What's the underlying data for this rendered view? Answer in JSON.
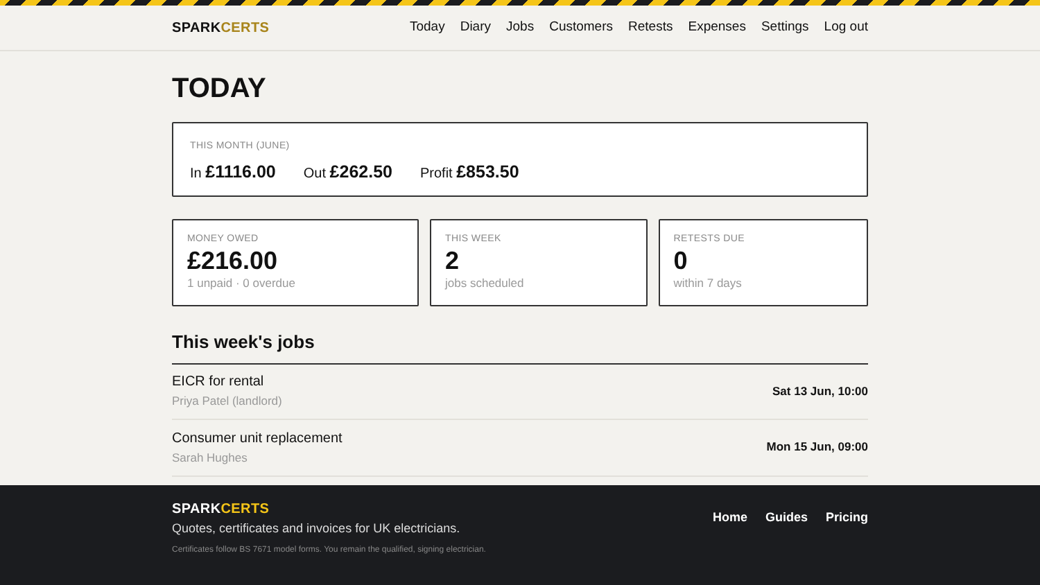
{
  "header": {
    "logo": {
      "part_1": "SPARK",
      "part_2": "CERTS"
    },
    "nav": [
      "Today",
      "Diary",
      "Jobs",
      "Customers",
      "Retests",
      "Expenses",
      "Settings",
      "Log out"
    ]
  },
  "page_title": "TODAY",
  "month_summary": {
    "label": "THIS MONTH (JUNE)",
    "figures": [
      {
        "label": "In",
        "value": "£1116.00"
      },
      {
        "label": "Out",
        "value": "£262.50"
      },
      {
        "label": "Profit",
        "value": "£853.50"
      }
    ]
  },
  "stats": [
    {
      "label": "MONEY OWED",
      "value": "£216.00",
      "note": "1 unpaid · 0 overdue"
    },
    {
      "label": "THIS WEEK",
      "value": "2",
      "note": "jobs scheduled"
    },
    {
      "label": "RETESTS DUE",
      "value": "0",
      "note": "within 7 days"
    }
  ],
  "jobs_section": {
    "title": "This week's jobs",
    "jobs": [
      {
        "title": "EICR for rental",
        "customer": "Priya Patel (landlord)",
        "when": "Sat 13 Jun, 10:00"
      },
      {
        "title": "Consumer unit replacement",
        "customer": "Sarah Hughes",
        "when": "Mon 15 Jun, 09:00"
      }
    ]
  },
  "footer": {
    "logo": {
      "part_1": "SPARK",
      "part_2": "CERTS"
    },
    "tagline": "Quotes, certificates and invoices for UK electricians.",
    "links": [
      "Home",
      "Guides",
      "Pricing"
    ],
    "note": "Certificates follow BS 7671 model forms. You remain the qualified, signing electrician."
  }
}
